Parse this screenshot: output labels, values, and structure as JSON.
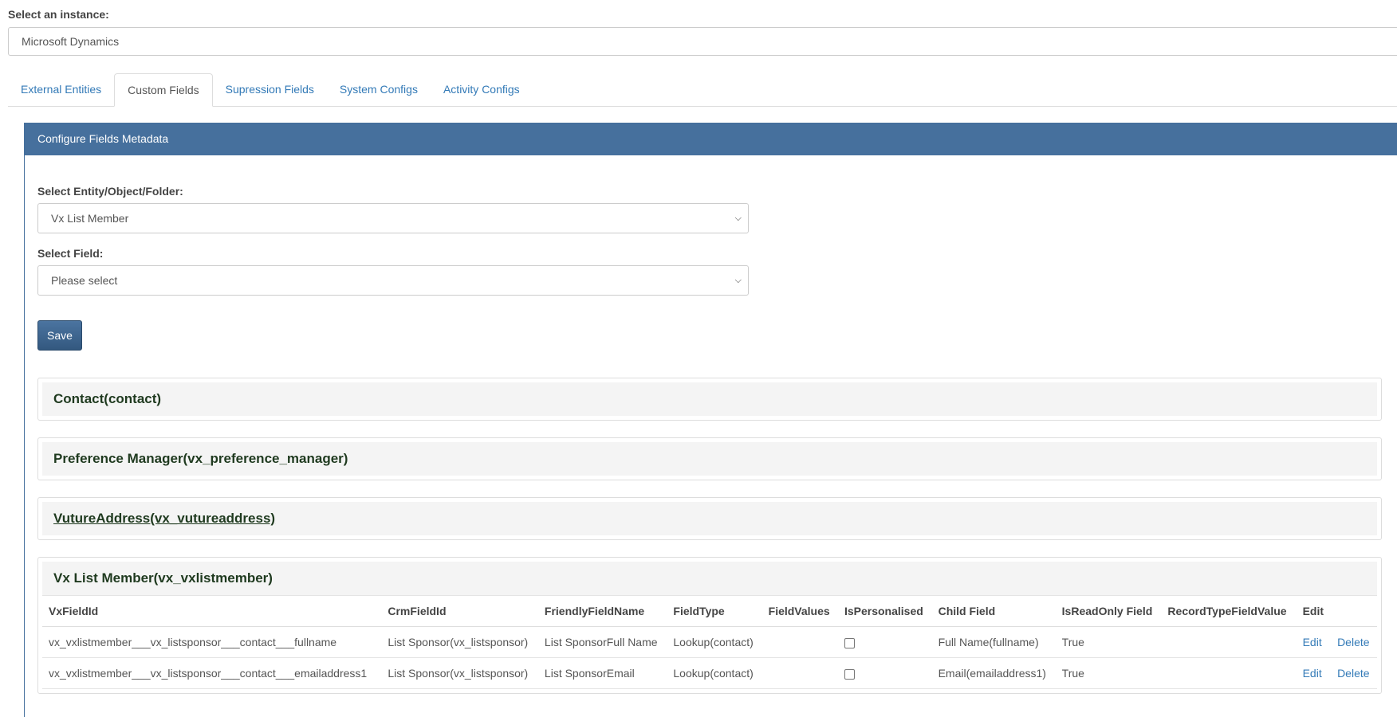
{
  "instance": {
    "label": "Select an instance:",
    "value": "Microsoft Dynamics"
  },
  "tabs": [
    {
      "label": "External Entities"
    },
    {
      "label": "Custom Fields"
    },
    {
      "label": "Supression Fields"
    },
    {
      "label": "System Configs"
    },
    {
      "label": "Activity Configs"
    }
  ],
  "panel": {
    "title": "Configure Fields Metadata",
    "entity_label": "Select Entity/Object/Folder:",
    "entity_value": "Vx List Member",
    "field_label": "Select Field:",
    "field_value": "Please select",
    "save_label": "Save"
  },
  "groups": [
    {
      "title": "Contact(contact)"
    },
    {
      "title": "Preference Manager(vx_preference_manager)"
    },
    {
      "title": "VutureAddress(vx_vutureaddress)"
    },
    {
      "title": "Vx List Member(vx_vxlistmember)"
    }
  ],
  "table": {
    "headers": [
      "VxFieldId",
      "CrmFieldId",
      "FriendlyFieldName",
      "FieldType",
      "FieldValues",
      "IsPersonalised",
      "Child Field",
      "IsReadOnly Field",
      "RecordTypeFieldValue",
      "Edit"
    ],
    "rows": [
      {
        "vx_field_id": "vx_vxlistmember___vx_listsponsor___contact___fullname",
        "crm_field_id": "List Sponsor(vx_listsponsor)",
        "friendly_name": "List SponsorFull Name",
        "field_type": "Lookup(contact)",
        "field_values": "",
        "child_field": "Full Name(fullname)",
        "is_read_only": "True",
        "record_type_value": "",
        "edit_label": "Edit",
        "delete_label": "Delete"
      },
      {
        "vx_field_id": "vx_vxlistmember___vx_listsponsor___contact___emailaddress1",
        "crm_field_id": "List Sponsor(vx_listsponsor)",
        "friendly_name": "List SponsorEmail",
        "field_type": "Lookup(contact)",
        "field_values": "",
        "child_field": "Email(emailaddress1)",
        "is_read_only": "True",
        "record_type_value": "",
        "edit_label": "Edit",
        "delete_label": "Delete"
      }
    ]
  }
}
